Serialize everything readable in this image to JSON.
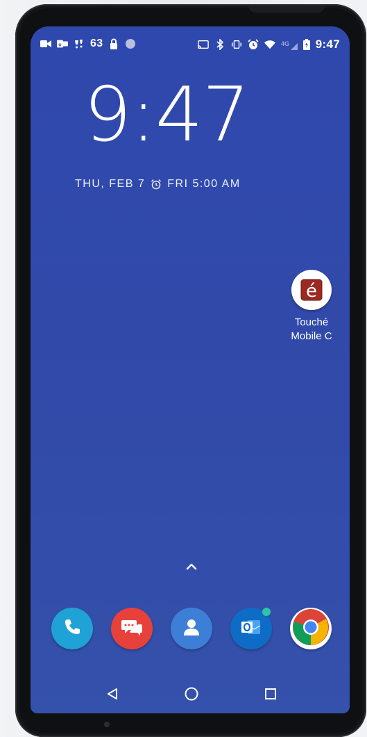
{
  "status_bar": {
    "left_icons": [
      "video-icon",
      "outlook-notification-icon",
      "voicemail-icon",
      "temperature-63",
      "lock-icon",
      "circle-dot-icon"
    ],
    "temperature": "63",
    "right_icons": [
      "cast-icon",
      "bluetooth-icon",
      "vibrate-icon",
      "alarm-icon",
      "wifi-icon",
      "4g-lte-icon",
      "signal-icon",
      "battery-icon"
    ],
    "network": "4G",
    "time": "9:47"
  },
  "lock_clock": {
    "time": "9:47",
    "date": "THU, FEB 7",
    "alarm": "FRI 5:00 AM"
  },
  "desktop_apps": [
    {
      "label_line1": "Touché",
      "label_line2": "Mobile C",
      "icon": "touche-app-icon"
    }
  ],
  "dock": [
    {
      "name": "phone",
      "icon": "phone-icon",
      "color": "#1fa3d6"
    },
    {
      "name": "messages",
      "icon": "messages-icon",
      "color": "#e8403b"
    },
    {
      "name": "contacts",
      "icon": "contacts-icon",
      "color": "#3d7fd6"
    },
    {
      "name": "outlook",
      "icon": "outlook-icon",
      "color": "#0f6cc6",
      "badge": true
    },
    {
      "name": "chrome",
      "icon": "chrome-icon",
      "color": "#ffffff"
    }
  ],
  "nav": {
    "back": "back-icon",
    "home": "home-icon",
    "recents": "recents-icon"
  },
  "colors": {
    "wallpaper": "#3049ac",
    "phone_frame": "#0f1012"
  }
}
